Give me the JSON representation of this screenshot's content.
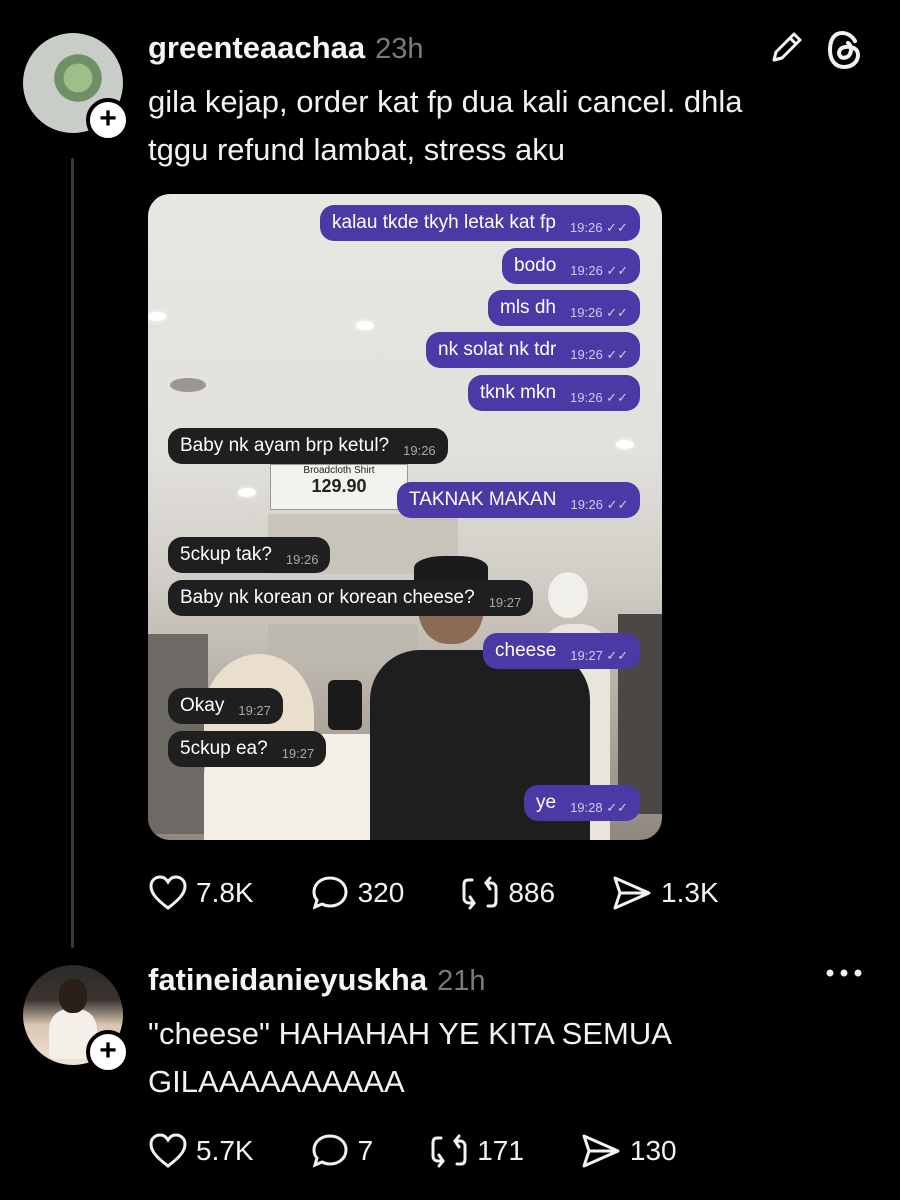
{
  "posts": [
    {
      "username": "greenteaachaa",
      "time": "23h",
      "text_line1": "gila kejap, order kat fp dua kali cancel. dhla",
      "text_line2": "tggu refund lambat, stress aku",
      "likes": "7.8K",
      "replies": "320",
      "reposts": "886",
      "shares": "1.3K"
    },
    {
      "username": "fatineidanieyuskha",
      "time": "21h",
      "text_line1": "\"cheese\" HAHAHAH YE KITA SEMUA",
      "text_line2": "GILAAAAAAAAAA",
      "likes": "5.7K",
      "replies": "7",
      "reposts": "171",
      "shares": "130"
    }
  ],
  "chat": [
    {
      "dir": "out",
      "text": "kalau tkde tkyh letak kat fp",
      "time": "19:26"
    },
    {
      "dir": "out",
      "text": "bodo",
      "time": "19:26"
    },
    {
      "dir": "out",
      "text": "mls dh",
      "time": "19:26"
    },
    {
      "dir": "out",
      "text": "nk solat nk tdr",
      "time": "19:26"
    },
    {
      "dir": "out",
      "text": "tknk mkn",
      "time": "19:26"
    },
    {
      "dir": "in",
      "text": "Baby nk ayam brp ketul?",
      "time": "19:26"
    },
    {
      "dir": "out",
      "text": "TAKNAK MAKAN",
      "time": "19:26"
    },
    {
      "dir": "in",
      "text": "5ckup tak?",
      "time": "19:26"
    },
    {
      "dir": "in",
      "text": "Baby nk korean or korean cheese?",
      "time": "19:27"
    },
    {
      "dir": "out",
      "text": "cheese",
      "time": "19:27"
    },
    {
      "dir": "in",
      "text": "Okay",
      "time": "19:27"
    },
    {
      "dir": "in",
      "text": "5ckup ea?",
      "time": "19:27"
    },
    {
      "dir": "out",
      "text": "ye",
      "time": "19:28"
    }
  ],
  "store_sign": "Broadcloth Shirt",
  "store_price": "129.90",
  "colors": {
    "outgoing_bubble": "#4b3aa6",
    "incoming_bubble": "#1f1f1f",
    "background": "#000000"
  },
  "icons": [
    "edit-icon",
    "threads-logo-icon",
    "more-icon",
    "heart-icon",
    "reply-icon",
    "repost-icon",
    "share-icon",
    "plus-icon"
  ]
}
